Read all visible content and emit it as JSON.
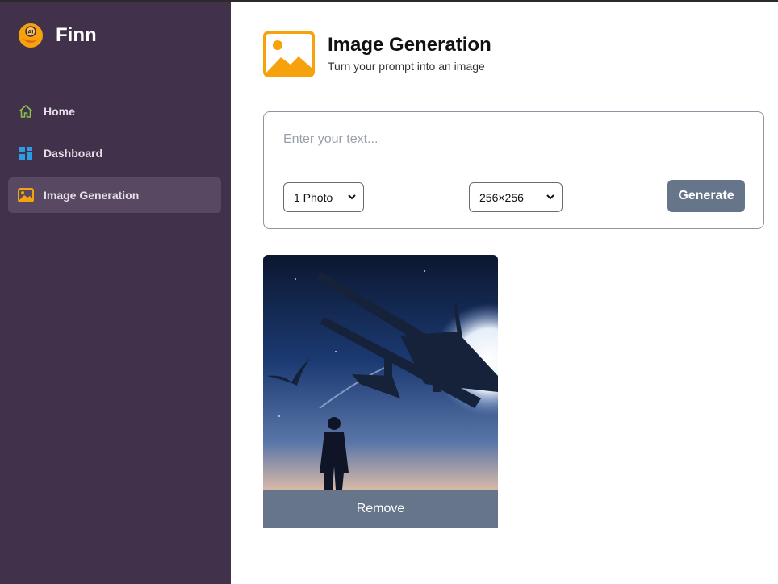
{
  "app": {
    "name": "Finn",
    "logo_icon": "finn-logo-icon"
  },
  "sidebar": {
    "items": [
      {
        "label": "Home",
        "icon": "home-icon",
        "active": false
      },
      {
        "label": "Dashboard",
        "icon": "dashboard-icon",
        "active": false
      },
      {
        "label": "Image Generation",
        "icon": "image-icon",
        "active": true
      }
    ]
  },
  "header": {
    "title": "Image Generation",
    "subtitle": "Turn your prompt into an image",
    "icon": "image-icon"
  },
  "prompt": {
    "placeholder": "Enter your text...",
    "value": "",
    "count_select": {
      "selected": "1 Photo"
    },
    "size_select": {
      "selected": "256×256"
    },
    "generate_label": "Generate"
  },
  "results": [
    {
      "image": "airplane-silhouette-night-image",
      "remove_label": "Remove"
    }
  ],
  "colors": {
    "sidebar_bg": "#42314b",
    "sidebar_active": "#584862",
    "accent_orange": "#f5a20c",
    "button_gray": "#66758a"
  }
}
